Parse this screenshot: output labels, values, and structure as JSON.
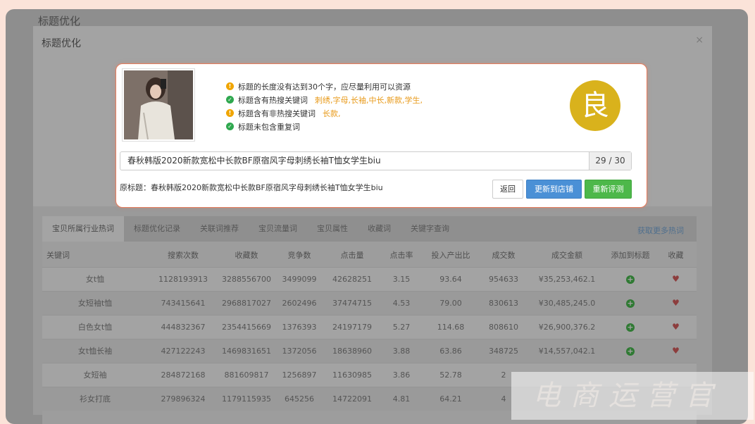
{
  "page": {
    "title": "标题优化"
  },
  "modal": {
    "title": "标题优化",
    "close": "×"
  },
  "card": {
    "checks": [
      {
        "type": "warn",
        "text": "标题的长度没有达到30个字，应尽量利用可以资源",
        "keywords": ""
      },
      {
        "type": "ok",
        "text": "标题含有热搜关键词",
        "keywords": "刺绣,字母,长袖,中长,新款,学生,"
      },
      {
        "type": "warn",
        "text": "标题含有非热搜关键词",
        "keywords": "长款,"
      },
      {
        "type": "ok",
        "text": "标题未包含重复词",
        "keywords": ""
      }
    ],
    "grade": "良",
    "title_value": "春秋韩版2020新款宽松中长款BF原宿风字母刺绣长袖T恤女学生biu",
    "title_count": "29 / 30",
    "original_title": "原标题：春秋韩版2020新款宽松中长款BF原宿风字母刺绣长袖T恤女学生biu",
    "buttons": {
      "back": "返回",
      "update": "更新到店铺",
      "reevaluate": "重新评测"
    }
  },
  "tabs": [
    "宝贝所属行业热词",
    "标题优化记录",
    "关联词推荐",
    "宝贝流量词",
    "宝贝属性",
    "收藏词",
    "关键字查询"
  ],
  "more_link": "获取更多热词",
  "table": {
    "headers": [
      "关键词",
      "搜索次数",
      "收藏数",
      "竞争数",
      "点击量",
      "点击率",
      "投入产出比",
      "成交数",
      "成交金额",
      "添加到标题",
      "收藏"
    ],
    "rows": [
      [
        "女t恤",
        "1128193913",
        "3288556700",
        "3499099",
        "42628251",
        "3.15",
        "93.64",
        "954633",
        "¥35,253,462.1"
      ],
      [
        "女短袖t恤",
        "743415641",
        "2968817027",
        "2602496",
        "37474715",
        "4.53",
        "79.00",
        "830613",
        "¥30,485,245.0"
      ],
      [
        "白色女t恤",
        "444832367",
        "2354415669",
        "1376393",
        "24197179",
        "5.27",
        "114.68",
        "808610",
        "¥26,900,376.2"
      ],
      [
        "女t恤长袖",
        "427122243",
        "1469831651",
        "1372056",
        "18638960",
        "3.88",
        "63.86",
        "348725",
        "¥14,557,042.1"
      ],
      [
        "女短袖",
        "284872168",
        "881609817",
        "1256897",
        "11630985",
        "3.86",
        "52.78",
        "2",
        ""
      ],
      [
        "衫女打底",
        "279896324",
        "1179115935",
        "645256",
        "14722091",
        "4.81",
        "64.21",
        "4",
        ""
      ]
    ]
  },
  "watermark": "电商运营官",
  "colors": {
    "accent_border": "#e97c5c",
    "grade": "#d9b21c",
    "update_btn": "#4a90d6",
    "reeval_btn": "#4db84a",
    "keyword": "#e89a1a"
  }
}
